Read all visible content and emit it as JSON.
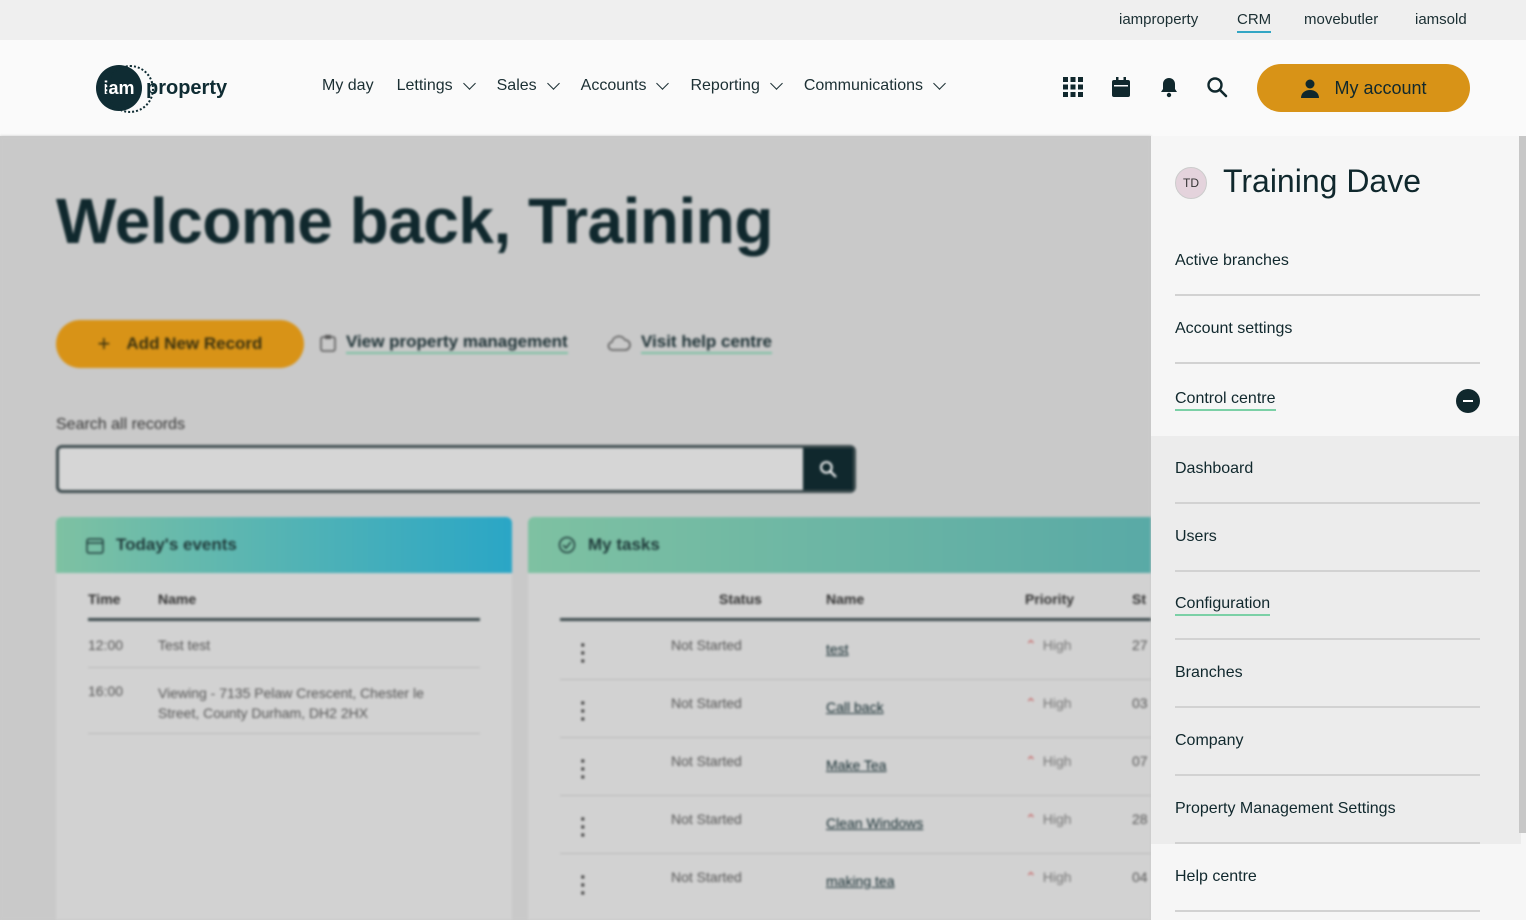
{
  "topbar": {
    "links": [
      "iamproperty",
      "CRM",
      "movebutler",
      "iamsold"
    ],
    "active": "CRM"
  },
  "header": {
    "logo": {
      "mark": "iam",
      "text": "property"
    },
    "nav": [
      "My day",
      "Lettings",
      "Sales",
      "Accounts",
      "Reporting",
      "Communications"
    ],
    "icons": [
      "apps-grid-icon",
      "calendar-icon",
      "bell-icon",
      "search-icon"
    ],
    "account_label": "My account"
  },
  "page": {
    "welcome": "Welcome back, Training",
    "add_record": "Add New Record",
    "view_pm": "View property management",
    "help": "Visit help centre",
    "search_label": "Search all records",
    "events": {
      "title": "Today's events",
      "columns": [
        "Time",
        "Name"
      ],
      "rows": [
        {
          "time": "12:00",
          "name": "Test test"
        },
        {
          "time": "16:00",
          "name": "Viewing - 7135 Pelaw Crescent, Chester le Street, County Durham, DH2 2HX"
        }
      ]
    },
    "tasks": {
      "title": "My tasks",
      "columns": [
        "Status",
        "Name",
        "Priority",
        "St"
      ],
      "rows": [
        {
          "status": "Not Started",
          "name": "test",
          "priority": "High",
          "start": "27"
        },
        {
          "status": "Not Started",
          "name": "Call back",
          "priority": "High",
          "start": "03"
        },
        {
          "status": "Not Started",
          "name": "Make Tea",
          "priority": "High",
          "start": "07"
        },
        {
          "status": "Not Started",
          "name": "Clean Windows",
          "priority": "High",
          "start": "28"
        },
        {
          "status": "Not Started",
          "name": "making tea",
          "priority": "High",
          "start": "04"
        }
      ]
    }
  },
  "panel": {
    "initials": "TD",
    "user_name": "Training Dave",
    "items": [
      "Active branches",
      "Account settings",
      "Control centre"
    ],
    "sub_items": [
      "Dashboard",
      "Users",
      "Configuration",
      "Branches",
      "Company",
      "Property Management Settings"
    ],
    "footer_item": "Help centre"
  },
  "colors": {
    "accent": "#d89317",
    "dark": "#10282d",
    "underline": "#7bd0a6"
  }
}
